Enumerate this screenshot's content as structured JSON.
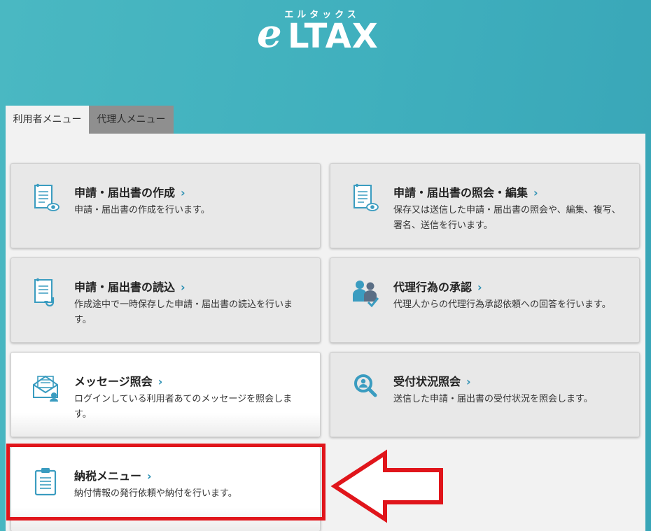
{
  "logo": {
    "kana": "エルタックス",
    "e": "e",
    "main": "LTAX"
  },
  "tabs": [
    {
      "label": "利用者メニュー",
      "active": true
    },
    {
      "label": "代理人メニュー",
      "active": false
    }
  ],
  "cards": [
    {
      "title": "申請・届出書の作成",
      "chevron": "›",
      "desc": "申請・届出書の作成を行います。",
      "icon": "document-eye-icon"
    },
    {
      "title": "申請・届出書の照会・編集",
      "chevron": "›",
      "desc": "保存又は送信した申請・届出書の照会や、編集、複写、署名、送信を行います。",
      "icon": "document-eye-icon"
    },
    {
      "title": "申請・届出書の読込",
      "chevron": "›",
      "desc": "作成途中で一時保存した申請・届出書の読込を行います。",
      "icon": "document-load-icon"
    },
    {
      "title": "代理行為の承認",
      "chevron": "›",
      "desc": "代理人からの代理行為承認依頼への回答を行います。",
      "icon": "people-check-icon"
    },
    {
      "title": "メッセージ照会",
      "chevron": "›",
      "desc": "ログインしている利用者あてのメッセージを照会します。",
      "icon": "envelope-icon"
    },
    {
      "title": "受付状況照会",
      "chevron": "›",
      "desc": "送信した申請・届出書の受付状況を照会します。",
      "icon": "magnifier-person-icon"
    },
    {
      "title": "納税メニュー",
      "chevron": "›",
      "desc": "納付情報の発行依頼や納付を行います。",
      "icon": "clipboard-icon"
    }
  ],
  "colors": {
    "accent": "#2a8fb3",
    "icon": "#3a9cc0",
    "highlight": "#e0151b"
  }
}
